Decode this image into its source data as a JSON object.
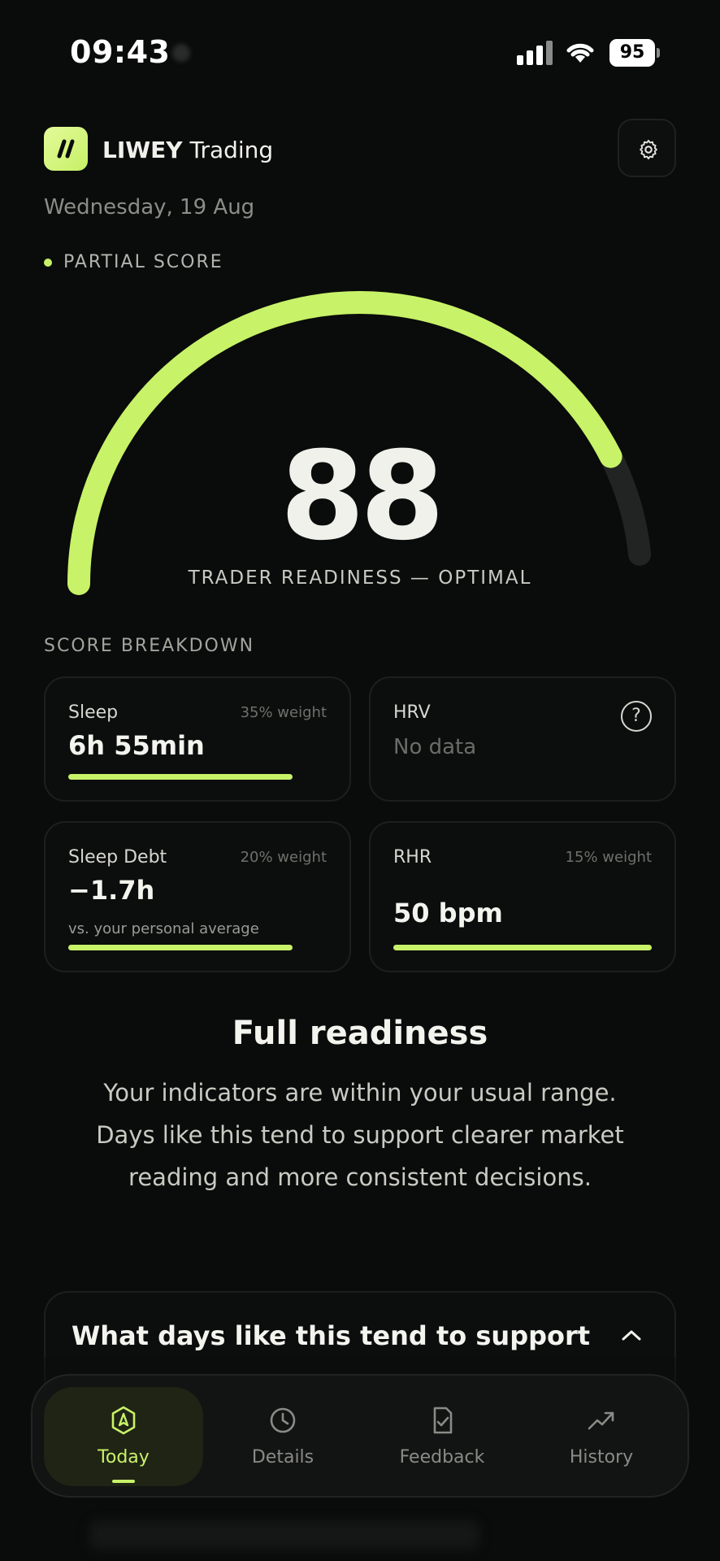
{
  "status_bar": {
    "time": "09:43",
    "battery": "95"
  },
  "header": {
    "app_brand": "LIWEY",
    "app_suffix": "Trading",
    "date": "Wednesday, 19 Aug"
  },
  "score": {
    "badge": "PARTIAL SCORE",
    "value": "88",
    "gauge_fraction": 0.88,
    "label": "TRADER READINESS — OPTIMAL"
  },
  "breakdown": {
    "title": "SCORE BREAKDOWN",
    "sleep": {
      "label": "Sleep",
      "weight": "35% weight",
      "value": "6h 55min",
      "progress": 1.0
    },
    "hrv": {
      "label": "HRV",
      "value": "No data"
    },
    "sleep_debt": {
      "label": "Sleep Debt",
      "weight": "20% weight",
      "value": "−1.7h",
      "sub": "vs. your personal average",
      "progress": 1.0
    },
    "rhr": {
      "label": "RHR",
      "weight": "15% weight",
      "value": "50 bpm",
      "progress": 1.0
    }
  },
  "summary": {
    "title": "Full readiness",
    "description": "Your indicators are within your usual range. Days like this tend to support clearer market reading and more consistent decisions."
  },
  "accordion": {
    "title": "What days like this tend to support"
  },
  "tabs": [
    {
      "label": "Today",
      "icon": "compass-badge-icon",
      "active": true
    },
    {
      "label": "Details",
      "icon": "clock-icon",
      "active": false
    },
    {
      "label": "Feedback",
      "icon": "clipboard-check-icon",
      "active": false
    },
    {
      "label": "History",
      "icon": "trend-up-icon",
      "active": false
    }
  ],
  "colors": {
    "accent": "#c8f268",
    "background": "#0a0b0b",
    "track": "#222423"
  }
}
